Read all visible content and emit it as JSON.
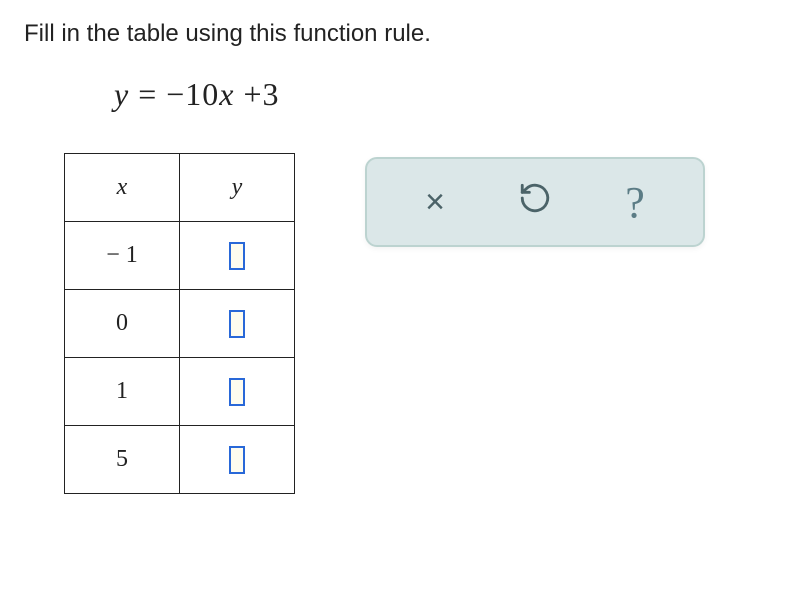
{
  "instruction": "Fill in the table using this function rule.",
  "equation": {
    "lhs": "y",
    "eq": "=",
    "rhs_neg": "−",
    "rhs_coef": "10",
    "rhs_var": "x",
    "rhs_plus": "+",
    "rhs_const": "3"
  },
  "table": {
    "headers": {
      "x": "x",
      "y": "y"
    },
    "rows": [
      {
        "x": "− 1",
        "y": ""
      },
      {
        "x": "0",
        "y": ""
      },
      {
        "x": "1",
        "y": ""
      },
      {
        "x": "5",
        "y": ""
      }
    ]
  },
  "tools": {
    "close": "×",
    "undo": "↺",
    "help": "?"
  }
}
